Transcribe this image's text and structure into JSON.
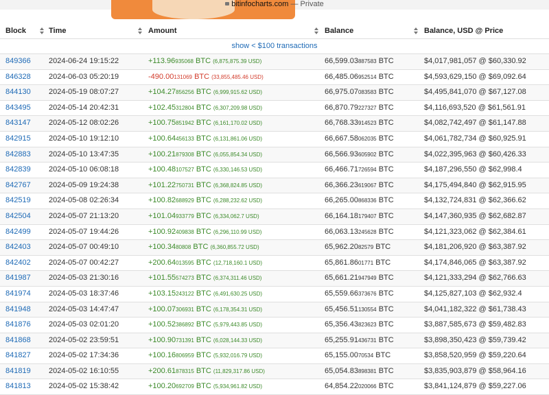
{
  "browser": {
    "domain": "bitinfocharts.com",
    "suffix": " — Private"
  },
  "headers": {
    "block": "Block",
    "time": "Time",
    "amount": "Amount",
    "balance": "Balance",
    "usd": "Balance, USD @ Price"
  },
  "show_link": "show < $100 transactions",
  "colors": {
    "link": "#1e6ab6",
    "positive": "#3c8a2a",
    "negative": "#d23b2b",
    "highlight_yellow": "#f9e05a",
    "highlight_green": "#7ddc6c"
  },
  "rows": [
    {
      "block": "849366",
      "time": "2024-06-24 19:15:22",
      "amt_main": "+113.96",
      "amt_small": "935068",
      "unit": " BTC",
      "amt_usd": "(6,875,875.39 USD)",
      "bal_main": "66,599.03",
      "bal_small": "887583",
      "bal_unit": " BTC",
      "usd": "$4,017,981,057 @ $60,330.92",
      "neg": false
    },
    {
      "block": "846328",
      "time": "2024-06-03 05:20:19",
      "amt_main": "-490.00",
      "amt_small": "131069",
      "unit": " BTC",
      "amt_usd": "(33,855,485.46 USD)",
      "bal_main": "66,485.06",
      "bal_small": "952514",
      "bal_unit": " BTC",
      "usd": "$4,593,629,150 @ $69,092.64",
      "neg": true
    },
    {
      "block": "844130",
      "time": "2024-05-19 08:07:27",
      "amt_main": "+104.27",
      "amt_small": "856256",
      "unit": " BTC",
      "amt_usd": "(6,999,915.62 USD)",
      "bal_main": "66,975.07",
      "bal_small": "083583",
      "bal_unit": " BTC",
      "usd": "$4,495,841,070 @ $67,127.08",
      "neg": false
    },
    {
      "block": "843495",
      "time": "2024-05-14 20:42:31",
      "amt_main": "+102.45",
      "amt_small": "312804",
      "unit": " BTC",
      "amt_usd": "(6,307,209.98 USD)",
      "bal_main": "66,870.79",
      "bal_small": "227327",
      "bal_unit": " BTC",
      "usd": "$4,116,693,520 @ $61,561.91",
      "neg": false
    },
    {
      "block": "843147",
      "time": "2024-05-12 08:02:26",
      "amt_main": "+100.75",
      "amt_small": "851942",
      "unit": " BTC",
      "amt_usd": "(6,161,170.02 USD)",
      "bal_main": "66,768.33",
      "bal_small": "914523",
      "bal_unit": " BTC",
      "usd": "$4,082,742,497 @ $61,147.88",
      "neg": false
    },
    {
      "block": "842915",
      "time": "2024-05-10 19:12:10",
      "amt_main": "+100.64",
      "amt_small": "456133",
      "unit": " BTC",
      "amt_usd": "(6,131,861.06 USD)",
      "bal_main": "66,667.58",
      "bal_small": "062035",
      "bal_unit": " BTC",
      "usd": "$4,061,782,734 @ $60,925.91",
      "neg": false
    },
    {
      "block": "842883",
      "time": "2024-05-10 13:47:35",
      "amt_main": "+100.21",
      "amt_small": "879308",
      "unit": " BTC",
      "amt_usd": "(6,055,854.34 USD)",
      "bal_main": "66,566.93",
      "bal_small": "605902",
      "bal_unit": " BTC",
      "usd": "$4,022,395,963 @ $60,426.33",
      "neg": false
    },
    {
      "block": "842839",
      "time": "2024-05-10 06:08:18",
      "amt_main": "+100.48",
      "amt_small": "107527",
      "unit": " BTC",
      "amt_usd": "(6,330,146.53 USD)",
      "bal_main": "66,466.71",
      "bal_small": "726594",
      "bal_unit": " BTC",
      "usd": "$4,187,296,550 @ $62,998.4",
      "neg": false
    },
    {
      "block": "842767",
      "time": "2024-05-09 19:24:38",
      "amt_main": "+101.22",
      "amt_small": "750731",
      "unit": " BTC",
      "amt_usd": "(6,368,824.85 USD)",
      "bal_main": "66,366.23",
      "bal_small": "619067",
      "bal_unit": " BTC",
      "usd": "$4,175,494,840 @ $62,915.95",
      "neg": false
    },
    {
      "block": "842519",
      "time": "2024-05-08 02:26:34",
      "amt_main": "+100.82",
      "amt_small": "688929",
      "unit": " BTC",
      "amt_usd": "(6,288,232.62 USD)",
      "bal_main": "66,265.00",
      "bal_small": "868336",
      "bal_unit": " BTC",
      "usd": "$4,132,724,831 @ $62,366.62",
      "neg": false
    },
    {
      "block": "842504",
      "time": "2024-05-07 21:13:20",
      "amt_main": "+101.04",
      "amt_small": "933779",
      "unit": " BTC",
      "amt_usd": "(6,334,062.7 USD)",
      "bal_main": "66,164.18",
      "bal_small": "179407",
      "bal_unit": " BTC",
      "usd": "$4,147,360,935 @ $62,682.87",
      "neg": false
    },
    {
      "block": "842499",
      "time": "2024-05-07 19:44:26",
      "amt_main": "+100.92",
      "amt_small": "409838",
      "unit": " BTC",
      "amt_usd": "(6,296,110.99 USD)",
      "bal_main": "66,063.13",
      "bal_small": "245628",
      "bal_unit": " BTC",
      "usd": "$4,121,323,062 @ $62,384.61",
      "neg": false
    },
    {
      "block": "842403",
      "time": "2024-05-07 00:49:10",
      "amt_main": "+100.34",
      "amt_small": "80808",
      "unit": " BTC",
      "amt_usd": "(6,360,855.72 USD)",
      "bal_main": "65,962.20",
      "bal_small": "82579",
      "bal_unit": " BTC",
      "usd": "$4,181,206,920 @ $63,387.92",
      "neg": false
    },
    {
      "block": "842402",
      "time": "2024-05-07 00:42:27",
      "amt_main": "+200.64",
      "amt_small": "013595",
      "unit": " BTC",
      "amt_usd": "(12,718,160.1 USD)",
      "bal_main": "65,861.86",
      "bal_small": "01771",
      "bal_unit": " BTC",
      "usd": "$4,174,846,065 @ $63,387.92",
      "neg": false
    },
    {
      "block": "841987",
      "time": "2024-05-03 21:30:16",
      "amt_main": "+101.55",
      "amt_small": "574273",
      "unit": " BTC",
      "amt_usd": "(6,374,311.46 USD)",
      "bal_main": "65,661.21",
      "bal_small": "947949",
      "bal_unit": " BTC",
      "usd": "$4,121,333,294 @ $62,766.63",
      "neg": false
    },
    {
      "block": "841974",
      "time": "2024-05-03 18:37:46",
      "amt_main": "+103.15",
      "amt_small": "243122",
      "unit": " BTC",
      "amt_usd": "(6,491,630.25 USD)",
      "bal_main": "65,559.66",
      "bal_small": "373676",
      "bal_unit": " BTC",
      "usd": "$4,125,827,103 @ $62,932.4",
      "neg": false
    },
    {
      "block": "841948",
      "time": "2024-05-03 14:47:47",
      "amt_main": "+100.07",
      "amt_small": "306931",
      "unit": " BTC",
      "amt_usd": "(6,178,354.31 USD)",
      "bal_main": "65,456.51",
      "bal_small": "130554",
      "bal_unit": " BTC",
      "usd": "$4,041,182,322 @ $61,738.43",
      "neg": false
    },
    {
      "block": "841876",
      "time": "2024-05-03 02:01:20",
      "amt_main": "+100.52",
      "amt_small": "386892",
      "unit": " BTC",
      "amt_usd": "(5,979,443.85 USD)",
      "bal_main": "65,356.43",
      "bal_small": "823623",
      "bal_unit": " BTC",
      "usd": "$3,887,585,673 @ $59,482.83",
      "neg": false
    },
    {
      "block": "841868",
      "time": "2024-05-02 23:59:51",
      "amt_main": "+100.90",
      "amt_small": "731391",
      "unit": " BTC",
      "amt_usd": "(6,028,144.33 USD)",
      "bal_main": "65,255.91",
      "bal_small": "436731",
      "bal_unit": " BTC",
      "usd": "$3,898,350,423 @ $59,739.42",
      "neg": false
    },
    {
      "block": "841827",
      "time": "2024-05-02 17:34:36",
      "amt_main": "+100.16",
      "amt_small": "806959",
      "unit": " BTC",
      "amt_usd": "(5,932,016.79 USD)",
      "bal_main": "65,155.00",
      "bal_small": "70534",
      "bal_unit": " BTC",
      "usd": "$3,858,520,959 @ $59,220.64",
      "neg": false
    },
    {
      "block": "841819",
      "time": "2024-05-02 16:10:55",
      "amt_main": "+200.61",
      "amt_small": "878315",
      "unit": " BTC",
      "amt_usd": "(11,829,317.86 USD)",
      "bal_main": "65,054.83",
      "bal_small": "898381",
      "bal_unit": " BTC",
      "usd": "$3,835,903,879 @ $58,964.16",
      "neg": false
    },
    {
      "block": "841813",
      "time": "2024-05-02 15:38:42",
      "amt_main": "+100.20",
      "amt_small": "692709",
      "unit": " BTC",
      "amt_usd": "(5,934,961.82 USD)",
      "bal_main": "64,854.22",
      "bal_small": "020066",
      "bal_unit": " BTC",
      "usd": "$3,841,124,879 @ $59,227.06",
      "neg": false
    }
  ]
}
